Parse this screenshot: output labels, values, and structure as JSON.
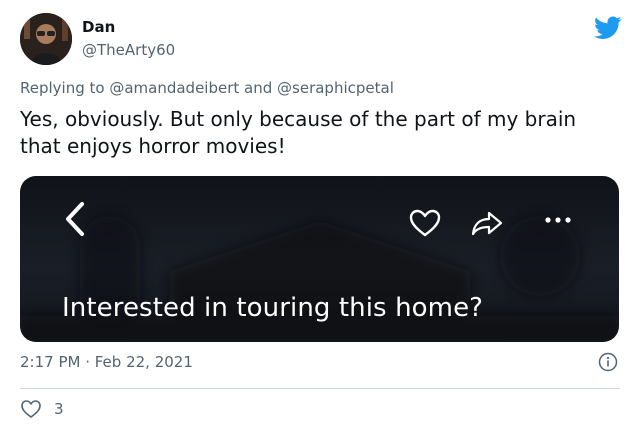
{
  "tweet": {
    "author_name": "Dan",
    "author_handle": "@TheArty60",
    "reply_line": "Replying to @amandadeibert and @seraphicpetal",
    "text": "Yes, obviously. But only because of the part of my brain that enjoys horror movies!",
    "media": {
      "caption": "Interested in touring this home?",
      "icons": [
        "chevron-left-icon",
        "heart-outline-icon",
        "share-arrow-icon",
        "more-dots-icon"
      ]
    },
    "timestamp": "2:17 PM · Feb 22, 2021",
    "like_count": "3"
  },
  "colors": {
    "brand": "#1d9bf0",
    "text_primary": "#0f1419",
    "text_secondary": "#536471",
    "divider": "#cfd9de",
    "media_background": "#15181f"
  }
}
